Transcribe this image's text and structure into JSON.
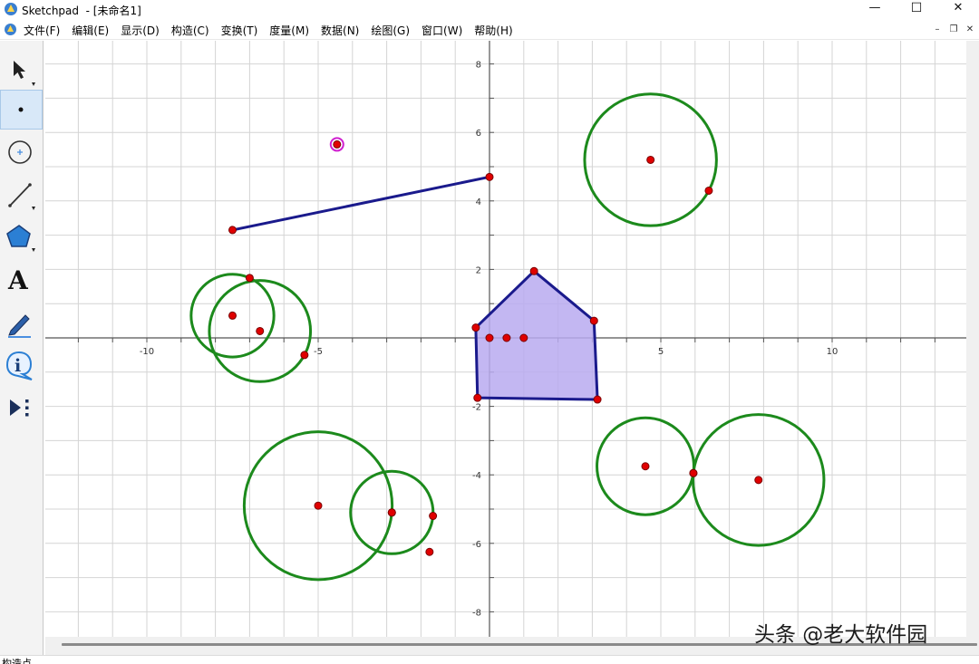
{
  "window": {
    "title": "Sketchpad  - [未命名1]",
    "controls": {
      "minimize": "—",
      "maximize": "☐",
      "close": "✕"
    }
  },
  "menubar": {
    "items": [
      "文件(F)",
      "编辑(E)",
      "显示(D)",
      "构造(C)",
      "变换(T)",
      "度量(M)",
      "数据(N)",
      "绘图(G)",
      "窗口(W)",
      "帮助(H)"
    ],
    "doc_controls": {
      "minimize": "–",
      "restore": "❐",
      "close": "✕"
    }
  },
  "toolbox": {
    "tools": [
      {
        "name": "arrow-select-tool",
        "icon": "arrow-cursor-icon"
      },
      {
        "name": "point-tool",
        "icon": "point-icon",
        "selected": true
      },
      {
        "name": "compass-tool",
        "icon": "circle-icon"
      },
      {
        "name": "straightedge-tool",
        "icon": "segment-icon"
      },
      {
        "name": "polygon-tool",
        "icon": "pentagon-icon"
      },
      {
        "name": "text-tool",
        "icon": "text-a-icon",
        "label": "A"
      },
      {
        "name": "marker-tool",
        "icon": "pen-icon"
      },
      {
        "name": "information-tool",
        "icon": "info-icon",
        "label": "i"
      },
      {
        "name": "custom-tool",
        "icon": "play-menu-icon"
      }
    ]
  },
  "graph": {
    "x_tick_labels": [
      "-10",
      "-5",
      "5",
      "10"
    ],
    "y_tick_labels": [
      "8",
      "6",
      "4",
      "2",
      "-2",
      "-4",
      "-6",
      "-8"
    ],
    "colors": {
      "grid": "#d4d4d4",
      "axis": "#555555",
      "circle": "#1c8a1c",
      "segment": "#1a1a8c",
      "polygon_fill": "#b9aaf0",
      "polygon_edge": "#1a1a8c",
      "point": "#e00000",
      "highlight_point": "#d020d0"
    },
    "segment": {
      "from": [
        -7.5,
        3.15
      ],
      "to": [
        0.0,
        4.7
      ]
    },
    "polygon": [
      [
        -0.4,
        0.3
      ],
      [
        1.3,
        1.95
      ],
      [
        3.05,
        0.5
      ],
      [
        3.15,
        -1.8
      ],
      [
        -0.35,
        -1.75
      ]
    ],
    "polygon_points": [
      [
        0.0,
        0.0
      ],
      [
        0.5,
        0.0
      ],
      [
        1.0,
        0.0
      ]
    ],
    "circles": [
      {
        "center": [
          4.7,
          5.2
        ],
        "through": [
          6.4,
          4.3
        ]
      },
      {
        "center": [
          -7.5,
          0.65
        ],
        "through": [
          -7.0,
          1.75
        ]
      },
      {
        "center": [
          -6.7,
          0.2
        ],
        "through": [
          -5.4,
          -0.5
        ]
      },
      {
        "center": [
          -5.0,
          -4.9
        ],
        "through": [
          -2.85,
          -5.1
        ]
      },
      {
        "center": [
          -2.85,
          -5.1
        ],
        "through": [
          -1.65,
          -5.2
        ]
      },
      {
        "center": [
          4.55,
          -3.75
        ],
        "through": [
          5.95,
          -3.95
        ]
      },
      {
        "center": [
          7.85,
          -4.15
        ],
        "through": [
          5.95,
          -3.95
        ]
      }
    ],
    "free_points": [
      [
        -1.75,
        -6.25
      ]
    ],
    "highlight_point": [
      -4.45,
      5.65
    ]
  },
  "status": {
    "text": "构造点"
  },
  "watermark": "头条 @老大软件园"
}
